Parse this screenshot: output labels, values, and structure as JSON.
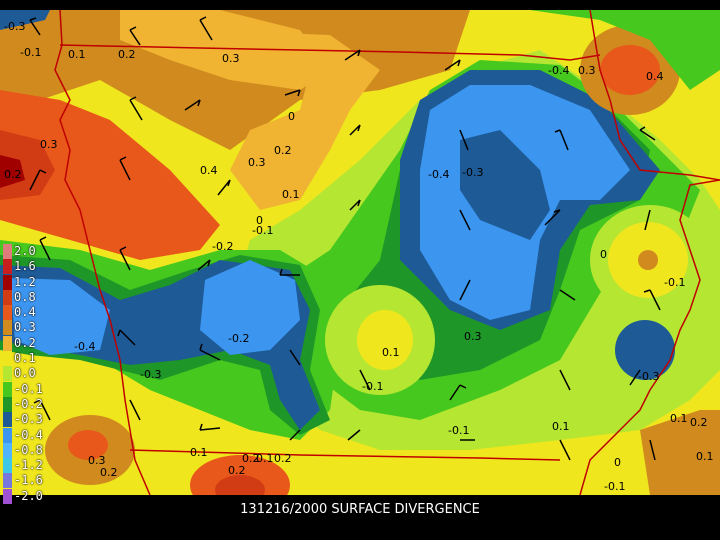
{
  "caption": "131216/2000 SURFACE DIVERGENCE",
  "legend": [
    {
      "label": "2.0",
      "color": "#e07b7b"
    },
    {
      "label": "1.6",
      "color": "#c81e1e"
    },
    {
      "label": "1.2",
      "color": "#a00000"
    },
    {
      "label": "0.8",
      "color": "#d23c14"
    },
    {
      "label": "0.4",
      "color": "#e8581a"
    },
    {
      "label": "0.3",
      "color": "#d08a1e"
    },
    {
      "label": "0.2",
      "color": "#f0b432"
    },
    {
      "label": "0.1",
      "color": "#f0e61e"
    },
    {
      "label": "0.0",
      "color": "#b4e632"
    },
    {
      "label": "-0.1",
      "color": "#46c81e"
    },
    {
      "label": "-0.2",
      "color": "#1e9628"
    },
    {
      "label": "-0.3",
      "color": "#1e5a96"
    },
    {
      "label": "-0.4",
      "color": "#3c96f0"
    },
    {
      "label": "-0.8",
      "color": "#50b4ff"
    },
    {
      "label": "-1.2",
      "color": "#3cc8e6"
    },
    {
      "label": "-1.6",
      "color": "#7878dc"
    },
    {
      "label": "-2.0",
      "color": "#a050d2"
    }
  ],
  "contour_labels": [
    "-0.3",
    "-0.1",
    "0.1",
    "0.2",
    "0.3",
    "0.3",
    "0.2",
    "0.4",
    "0.3",
    "0.2",
    "0.1",
    "-0.1",
    "0",
    "-0.2",
    "0",
    "-0.4",
    "-0.3",
    "-0.4",
    "-0.3",
    "-0.2",
    "0",
    "-0.1",
    "0.1",
    "0.3",
    "0.4",
    "-0.3",
    "-0.4",
    "-0.1",
    "-0.1",
    "0.1",
    "0.1",
    "0.2",
    "0.3",
    "0.2",
    "0.1",
    "0.2",
    "0.2",
    "0.1",
    "-0.1",
    "0",
    "0.1",
    "0.2",
    "0.3"
  ]
}
